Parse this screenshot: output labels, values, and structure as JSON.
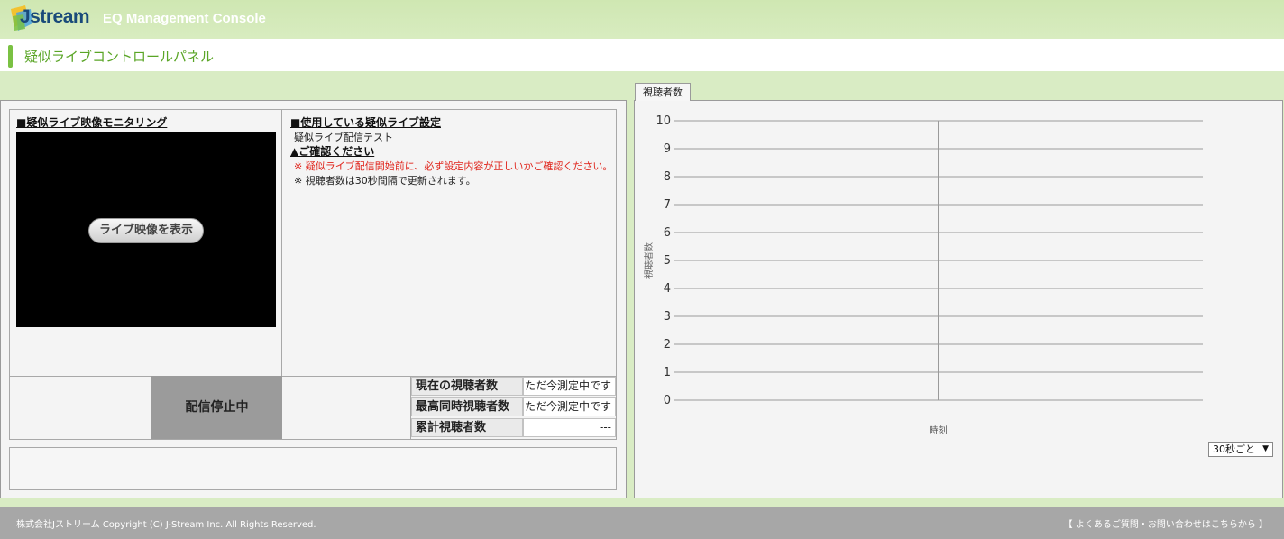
{
  "header": {
    "logo_text": "Jstream",
    "console_title": "EQ Management Console",
    "page_title": "疑似ライブコントロールパネル"
  },
  "monitoring": {
    "heading": "■疑似ライブ映像モニタリング",
    "show_video_button": "ライブ映像を表示"
  },
  "settings": {
    "heading": "■使用している疑似ライブ設定",
    "setting_name": "疑似ライブ配信テスト",
    "confirm_heading": "▲ご確認ください",
    "warning_note": "※ 疑似ライブ配信開始前に、必ず設定内容が正しいかご確認ください。",
    "update_note": "※ 視聴者数は30秒間隔で更新されます。"
  },
  "status": {
    "broadcast_status": "配信停止中"
  },
  "stats": [
    {
      "label": "現在の視聴者数",
      "value": "ただ今測定中です"
    },
    {
      "label": "最高同時視聴者数",
      "value": "ただ今測定中です"
    },
    {
      "label": "累計視聴者数",
      "value": "---"
    }
  ],
  "chart_tab": "視聴者数",
  "chart_data": {
    "type": "line",
    "title": "",
    "xlabel": "時刻",
    "ylabel": "視聴者数",
    "ylim": [
      0,
      10
    ],
    "y_ticks": [
      "0",
      "1",
      "2",
      "3",
      "4",
      "5",
      "6",
      "7",
      "8",
      "9",
      "10"
    ],
    "series": [],
    "grid": true
  },
  "interval_select": {
    "selected": "30秒ごと"
  },
  "footer": {
    "copyright": "株式会社Jストリーム Copyright (C) J-Stream Inc. All Rights Reserved.",
    "faq_link": "【 よくあるご質問・お問い合わせはこちらから 】"
  }
}
